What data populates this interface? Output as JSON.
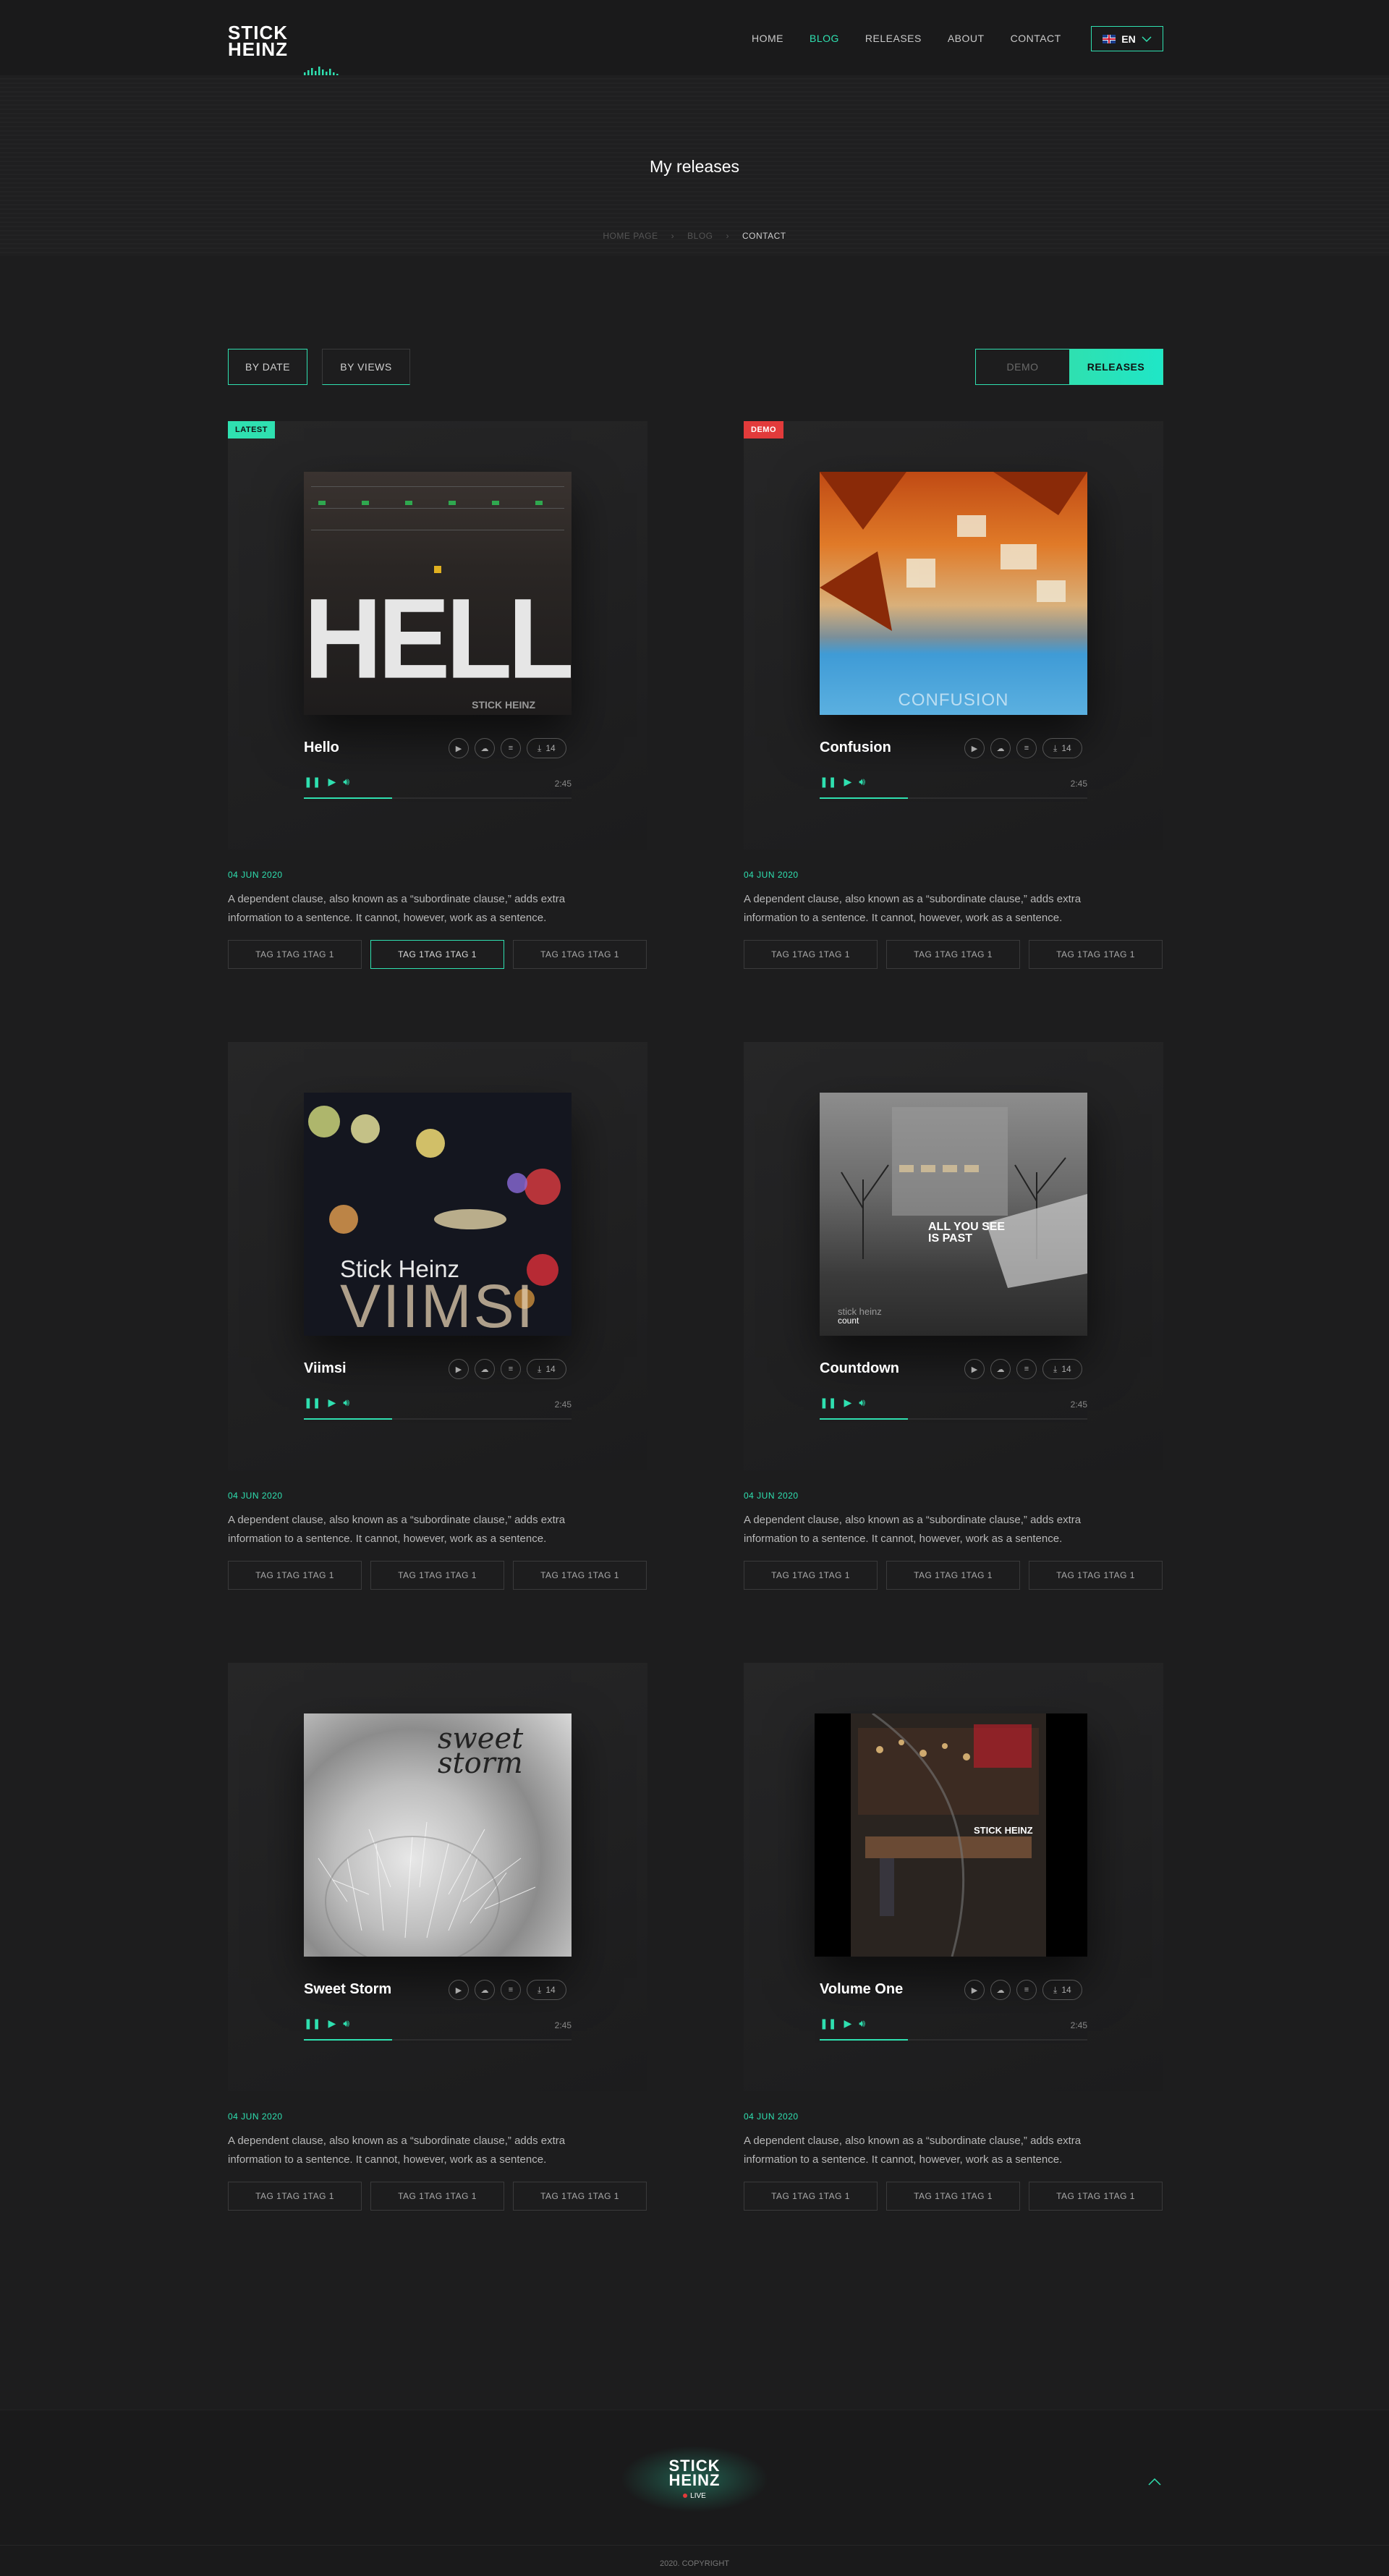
{
  "header": {
    "logo_line1": "STICK",
    "logo_line2": "HEINZ",
    "nav": [
      {
        "label": "HOME"
      },
      {
        "label": "BLOG"
      },
      {
        "label": "RELEASES"
      },
      {
        "label": "ABOUT"
      },
      {
        "label": "CONTACT"
      }
    ],
    "lang": "EN"
  },
  "hero": {
    "title": "My releases",
    "breadcrumb": [
      "HOME PAGE",
      "BLOG",
      "CONTACT"
    ]
  },
  "filters": {
    "by_date": "BY DATE",
    "by_views": "BY VIEWS",
    "demo": "DEMO",
    "releases": "RELEASES"
  },
  "cards": [
    {
      "badge": "LATEST",
      "title": "Hello",
      "downloads": "14",
      "time": "2:45",
      "date": "04 JUN 2020",
      "desc": "A dependent clause, also known as a “subordinate clause,” adds extra information to a sentence. It cannot, however, work as a sentence.",
      "tags": [
        "TAG 1TAG 1TAG 1",
        "TAG 1TAG 1TAG 1",
        "TAG 1TAG 1TAG 1"
      ],
      "cover_text": "HELLO",
      "cover_sub": "STICK HEINZ"
    },
    {
      "badge": "DEMO",
      "title": "Confusion",
      "downloads": "14",
      "time": "2:45",
      "date": "04 JUN 2020",
      "desc": "A dependent clause, also known as a “subordinate clause,” adds extra information to a sentence. It cannot, however, work as a sentence.",
      "tags": [
        "TAG 1TAG 1TAG 1",
        "TAG 1TAG 1TAG 1",
        "TAG 1TAG 1TAG 1"
      ],
      "cover_text": "CONFUSION"
    },
    {
      "title": "Viimsi",
      "downloads": "14",
      "time": "2:45",
      "date": "04 JUN 2020",
      "desc": "A dependent clause, also known as a “subordinate clause,” adds extra information to a sentence. It cannot, however, work as a sentence.",
      "tags": [
        "TAG 1TAG 1TAG 1",
        "TAG 1TAG 1TAG 1",
        "TAG 1TAG 1TAG 1"
      ],
      "cover_text": "VIIMSI",
      "cover_sub": "Stick Heinz"
    },
    {
      "title": "Countdown",
      "downloads": "14",
      "time": "2:45",
      "date": "04 JUN 2020",
      "desc": "A dependent clause, also known as a “subordinate clause,” adds extra information to a sentence. It cannot, however, work as a sentence.",
      "tags": [
        "TAG 1TAG 1TAG 1",
        "TAG 1TAG 1TAG 1",
        "TAG 1TAG 1TAG 1"
      ],
      "cover_text": "ALL YOU SEE IS PAST",
      "cover_sub": "stick heinz",
      "cover_sub2": "count"
    },
    {
      "title": "Sweet Storm",
      "downloads": "14",
      "time": "2:45",
      "date": "04 JUN 2020",
      "desc": "A dependent clause, also known as a “subordinate clause,” adds extra information to a sentence. It cannot, however, work as a sentence.",
      "tags": [
        "TAG 1TAG 1TAG 1",
        "TAG 1TAG 1TAG 1",
        "TAG 1TAG 1TAG 1"
      ],
      "cover_text": "sweet storm"
    },
    {
      "title": "Volume One",
      "downloads": "14",
      "time": "2:45",
      "date": "04 JUN 2020",
      "desc": "A dependent clause, also known as a “subordinate clause,” adds extra information to a sentence. It cannot, however, work as a sentence.",
      "tags": [
        "TAG 1TAG 1TAG 1",
        "TAG 1TAG 1TAG 1",
        "TAG 1TAG 1TAG 1"
      ],
      "cover_text": "STICK HEINZ"
    }
  ],
  "player": {
    "progress": 0.33
  },
  "footer": {
    "logo_line1": "STICK",
    "logo_line2": "HEINZ",
    "live": "LIVE",
    "copyright": "2020. COPYRIGHT"
  },
  "colors": {
    "accent": "#2fe0b0",
    "demo": "#e23b3b",
    "bg": "#1d1d1e"
  }
}
